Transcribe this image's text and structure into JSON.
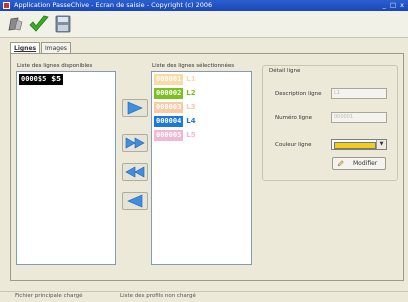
{
  "window": {
    "title": "Application PasseChive - Ecran de saisie - Copyright (c) 2006",
    "controls": "_ □ x"
  },
  "tabs": [
    {
      "label": "Lignes"
    },
    {
      "label": "Images"
    }
  ],
  "available": {
    "label": "Liste des lignes disponibles",
    "items": [
      {
        "code": "0000$5",
        "name": "$5",
        "color": "#000000",
        "text_color": "#ffffff"
      }
    ]
  },
  "selected": {
    "label": "Liste des lignes sélectionnées",
    "items": [
      {
        "code": "000001",
        "name": "L1",
        "color": "#f4c56a",
        "text_color": "#ffffff"
      },
      {
        "code": "000002",
        "name": "L2",
        "color": "#7cc21e",
        "text_color": "#ffffff"
      },
      {
        "code": "000003",
        "name": "L3",
        "color": "#f4a86a",
        "text_color": "#ffffff"
      },
      {
        "code": "000004",
        "name": "L4",
        "color": "#1b7ad9",
        "text_color": "#ffffff"
      },
      {
        "code": "000005",
        "name": "L5",
        "color": "#e889b8",
        "text_color": "#ffffff"
      }
    ]
  },
  "detail": {
    "title": "Détail ligne",
    "description_label": "Description ligne",
    "description_value": "L1",
    "number_label": "Numéro ligne",
    "number_value": "000001",
    "color_label": "Couleur ligne",
    "color_value": "#f2cd1d",
    "modify_label": "Modifier"
  },
  "status": {
    "left": "Fichier principale chargé",
    "right": "Liste des profils non chargé"
  }
}
